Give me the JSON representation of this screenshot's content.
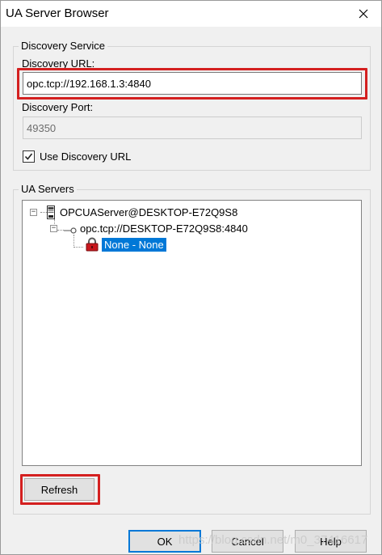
{
  "window": {
    "title": "UA Server Browser",
    "close_glyph": "✕"
  },
  "discovery": {
    "group_label": "Discovery Service",
    "url_label": "Discovery URL:",
    "url_value": "opc.tcp://192.168.1.3:4840",
    "port_label": "Discovery Port:",
    "port_value": "49350",
    "use_discovery_label": "Use Discovery URL",
    "use_discovery_checked": true
  },
  "servers": {
    "group_label": "UA Servers",
    "tree": {
      "root": {
        "label": "OPCUAServer@DESKTOP-E72Q9S8",
        "expander": "−",
        "icon": "server-icon"
      },
      "endpoint": {
        "label": "opc.tcp://DESKTOP-E72Q9S8:4840",
        "expander": "−",
        "icon": "endpoint-icon"
      },
      "security": {
        "label": "None - None",
        "icon": "lock-icon",
        "selected": true
      }
    }
  },
  "buttons": {
    "refresh": "Refresh",
    "ok": "OK",
    "cancel": "Cancel",
    "help": "Help"
  },
  "watermark": "https://blog.csdn.net/m0_37416617",
  "colors": {
    "highlight": "#d42020",
    "selection": "#0078d7"
  }
}
